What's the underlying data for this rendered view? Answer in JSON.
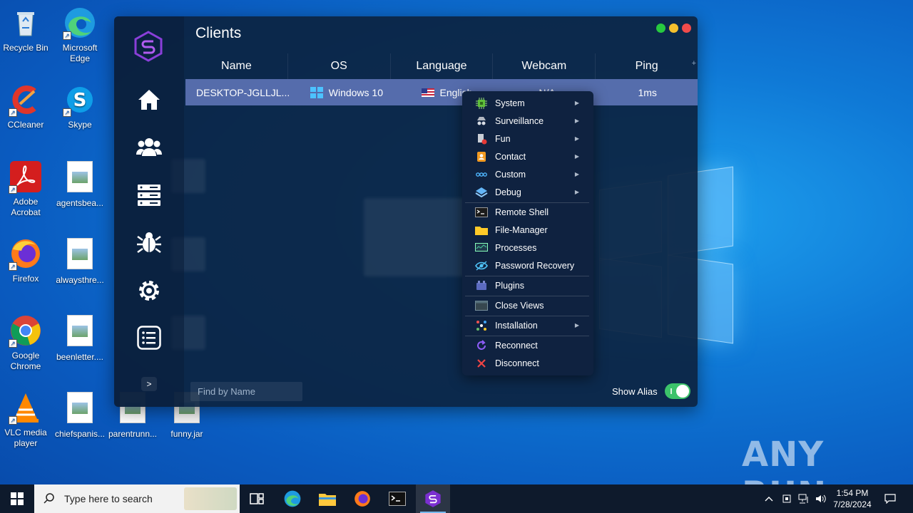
{
  "desktop": {
    "icons": [
      {
        "label": "Recycle Bin"
      },
      {
        "label": "Microsoft Edge"
      },
      {
        "label": "CCleaner"
      },
      {
        "label": "Skype"
      },
      {
        "label": "Adobe Acrobat"
      },
      {
        "label": "agentsbea..."
      },
      {
        "label": "Firefox"
      },
      {
        "label": "alwaysthre..."
      },
      {
        "label": "Google Chrome"
      },
      {
        "label": "beenletter...."
      },
      {
        "label": "VLC media player"
      },
      {
        "label": "chiefspanis..."
      },
      {
        "label": "parentrunn..."
      },
      {
        "label": "funny.jar"
      }
    ],
    "watermark": "ANY RUN"
  },
  "app": {
    "title": "Clients",
    "columns": [
      "Name",
      "OS",
      "Language",
      "Webcam",
      "Ping"
    ],
    "plus": "+",
    "client": {
      "name": "DESKTOP-JGLLJL...",
      "os": "Windows 10",
      "language": "English",
      "webcam": "N/A",
      "ping": "1ms"
    },
    "nav": [
      "home-icon",
      "users-icon",
      "servers-icon",
      "bug-icon",
      "settings-icon",
      "list-icon"
    ],
    "expand_label": ">",
    "search_placeholder": "Find by Name",
    "show_alias_label": "Show Alias",
    "show_alias_on": true,
    "traffic_colors": {
      "green": "#27c93f",
      "yellow": "#f5c02d",
      "red": "#f04b4b"
    }
  },
  "context_menu": {
    "items": [
      {
        "label": "System",
        "icon": "chip-icon",
        "submenu": true
      },
      {
        "label": "Surveillance",
        "icon": "spy-icon",
        "submenu": true
      },
      {
        "label": "Fun",
        "icon": "fun-icon",
        "submenu": true
      },
      {
        "label": "Contact",
        "icon": "contact-icon",
        "submenu": true
      },
      {
        "label": "Custom",
        "icon": "custom-icon",
        "submenu": true
      },
      {
        "label": "Debug",
        "icon": "debug-icon",
        "submenu": true
      },
      {
        "label": "Remote Shell",
        "icon": "terminal-icon",
        "submenu": false
      },
      {
        "label": "File-Manager",
        "icon": "folder-icon",
        "submenu": false
      },
      {
        "label": "Processes",
        "icon": "monitor-icon",
        "submenu": false
      },
      {
        "label": "Password Recovery",
        "icon": "eye-icon",
        "submenu": false
      },
      {
        "label": "Plugins",
        "icon": "plugin-icon",
        "submenu": false
      },
      {
        "label": "Close Views",
        "icon": "window-icon",
        "submenu": false
      },
      {
        "label": "Installation",
        "icon": "installation-icon",
        "submenu": true
      },
      {
        "label": "Reconnect",
        "icon": "reconnect-icon",
        "submenu": false
      },
      {
        "label": "Disconnect",
        "icon": "disconnect-icon",
        "submenu": false
      }
    ]
  },
  "taskbar": {
    "search_placeholder": "Type here to search",
    "time": "1:54 PM",
    "date": "7/28/2024"
  }
}
